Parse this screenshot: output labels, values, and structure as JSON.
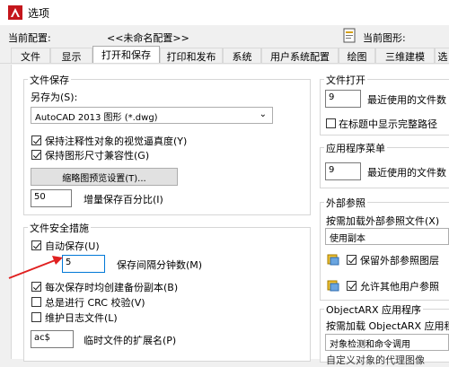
{
  "window": {
    "title": "选项"
  },
  "header": {
    "profile_label": "当前配置:",
    "profile_value": "<<未命名配置>>",
    "drawing_label": "当前图形:"
  },
  "tabs": [
    {
      "label": "文件"
    },
    {
      "label": "显示"
    },
    {
      "label": "打开和保存",
      "active": true
    },
    {
      "label": "打印和发布"
    },
    {
      "label": "系统"
    },
    {
      "label": "用户系统配置"
    },
    {
      "label": "绘图"
    },
    {
      "label": "三维建模"
    },
    {
      "label": "选"
    }
  ],
  "file_save": {
    "group_title": "文件保存",
    "save_as_label": "另存为(S):",
    "save_as_value": "AutoCAD 2013 图形 (*.dwg)",
    "checkbox_annotative": "保持注释性对象的视觉逼真度(Y)",
    "checkbox_size_compat": "保持图形尺寸兼容性(G)",
    "thumbnail_button": "缩略图预览设置(T)...",
    "incremental_value": "50",
    "incremental_label": "增量保存百分比(I)"
  },
  "safety": {
    "group_title": "文件安全措施",
    "autosave_label": "自动保存(U)",
    "interval_value": "5",
    "interval_label": "保存间隔分钟数(M)",
    "backup_label": "每次保存时均创建备份副本(B)",
    "crc_label": "总是进行 CRC 校验(V)",
    "log_label": "维护日志文件(L)",
    "temp_ext_value": "ac$",
    "temp_ext_label": "临时文件的扩展名(P)"
  },
  "file_open": {
    "group_title": "文件打开",
    "recent_value": "9",
    "recent_label": "最近使用的文件数",
    "fullpath_label": "在标题中显示完整路径"
  },
  "app_menu": {
    "group_title": "应用程序菜单",
    "recent_value": "9",
    "recent_label": "最近使用的文件数"
  },
  "xref": {
    "group_title": "外部参照",
    "demand_label": "按需加载外部参照文件(X)",
    "demand_value": "使用副本",
    "retain_label": "保留外部参照图层",
    "allow_label": "允许其他用户参照"
  },
  "objectarx": {
    "group_title": "ObjectARX 应用程序",
    "demand_label": "按需加载 ObjectARX 应用程",
    "demand_value": "对象检测和命令调用",
    "cut_text": "自定义对象的代理图像"
  },
  "colors": {
    "accent": "#0078d7",
    "arrow": "#e02020"
  }
}
